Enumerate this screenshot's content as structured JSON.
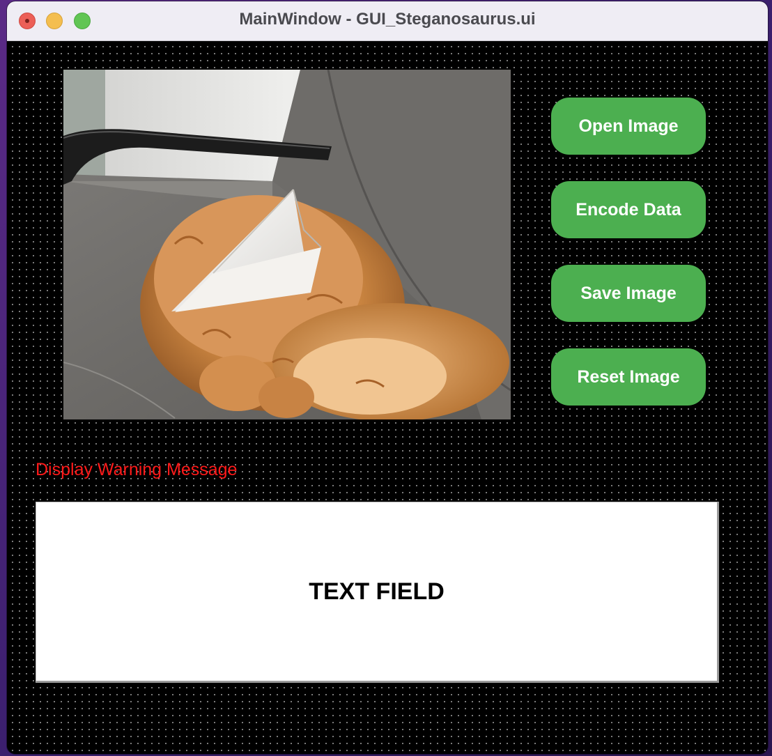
{
  "window": {
    "title": "MainWindow - GUI_Steganosaurus.ui"
  },
  "image_panel": {
    "description_icon": "cat-photo-image"
  },
  "buttons": {
    "open_image": "Open Image",
    "encode_data": "Encode Data",
    "save_image": "Save Image",
    "reset_image": "Reset Image"
  },
  "warning": {
    "message": "Display Warning Message",
    "color": "#ff1a1a"
  },
  "text_field": {
    "label": "TEXT FIELD"
  },
  "colors": {
    "button": "#4caf50",
    "background": "#000000"
  }
}
